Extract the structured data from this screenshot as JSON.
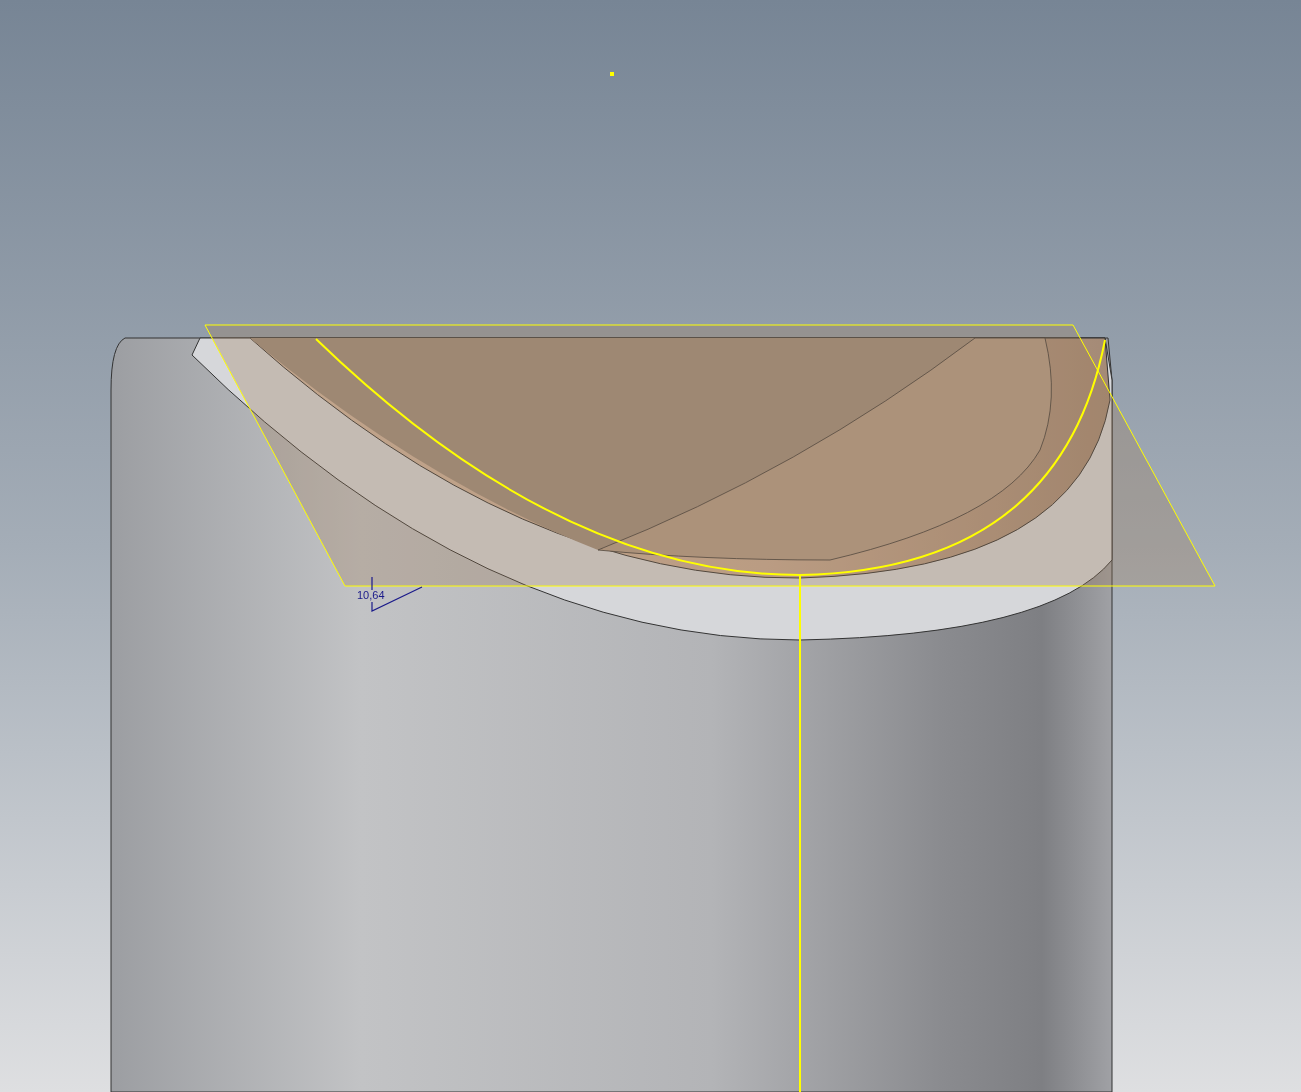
{
  "viewport": {
    "dimension": {
      "value": "10,64"
    }
  }
}
